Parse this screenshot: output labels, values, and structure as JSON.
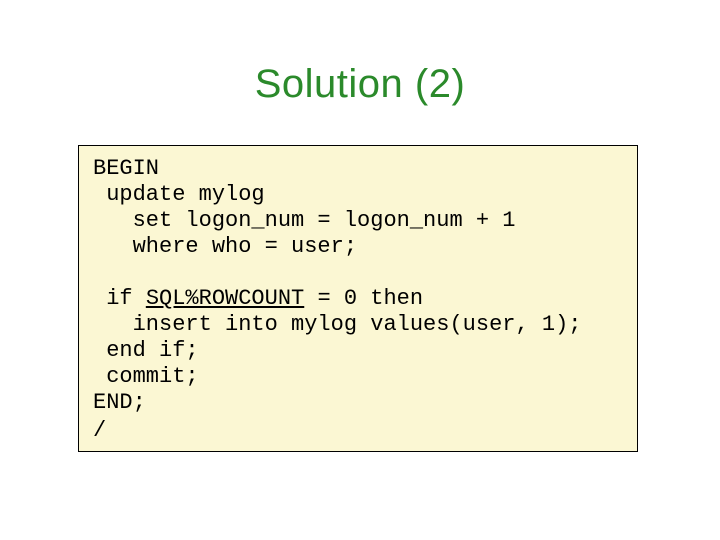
{
  "title": "Solution (2)",
  "code": {
    "l1": "BEGIN",
    "l2": " update mylog",
    "l3": "   set logon_num = logon_num + 1",
    "l4": "   where who = user;",
    "l5": "",
    "l6_pre": " if ",
    "l6_kw": "SQL%ROWCOUNT",
    "l6_post": " = 0 then",
    "l7": "   insert into mylog values(user, 1);",
    "l8": " end if;",
    "l9": " commit;",
    "l10": "END;",
    "slash": "/"
  }
}
